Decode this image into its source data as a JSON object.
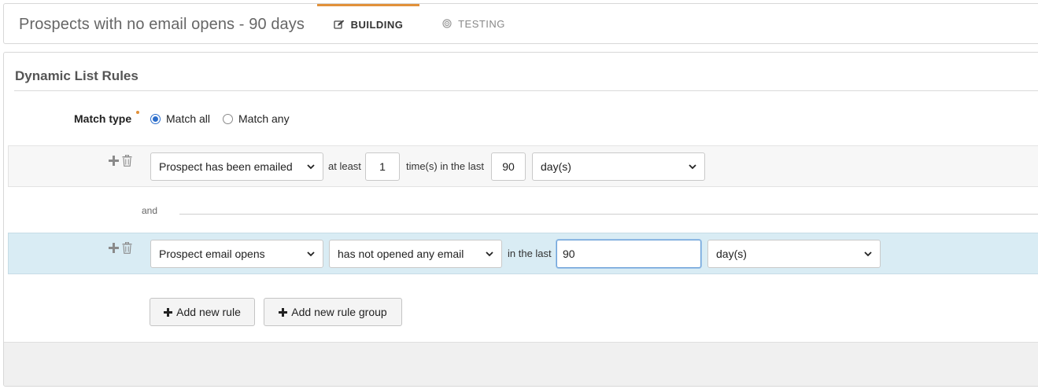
{
  "header": {
    "title": "Prospects with no email opens - 90 days",
    "tabs": [
      {
        "label": "BUILDING",
        "active": true,
        "icon": "edit-icon"
      },
      {
        "label": "TESTING",
        "active": false,
        "icon": "target-icon"
      }
    ]
  },
  "colors": {
    "accent_tab": "#e1913a",
    "highlight_row": "#d9ecf4",
    "radio_blue": "#2c6ecb"
  },
  "rules_section": {
    "title": "Dynamic List Rules",
    "match_type": {
      "label": "Match type",
      "options": [
        {
          "label": "Match all",
          "selected": true
        },
        {
          "label": "Match any",
          "selected": false
        }
      ]
    },
    "rules": [
      {
        "field": "Prospect has been emailed",
        "at_least_label": "at least",
        "count": "1",
        "times_label": "time(s) in the last",
        "period_value": "90",
        "period_unit": "day(s)"
      },
      {
        "field": "Prospect email opens",
        "operator": "has not opened any email",
        "in_the_last_label": "in the last",
        "period_value": "90",
        "period_unit": "day(s)"
      }
    ],
    "conjunction": "and",
    "buttons": {
      "add_rule": "Add new rule",
      "add_rule_group": "Add new rule group"
    }
  }
}
